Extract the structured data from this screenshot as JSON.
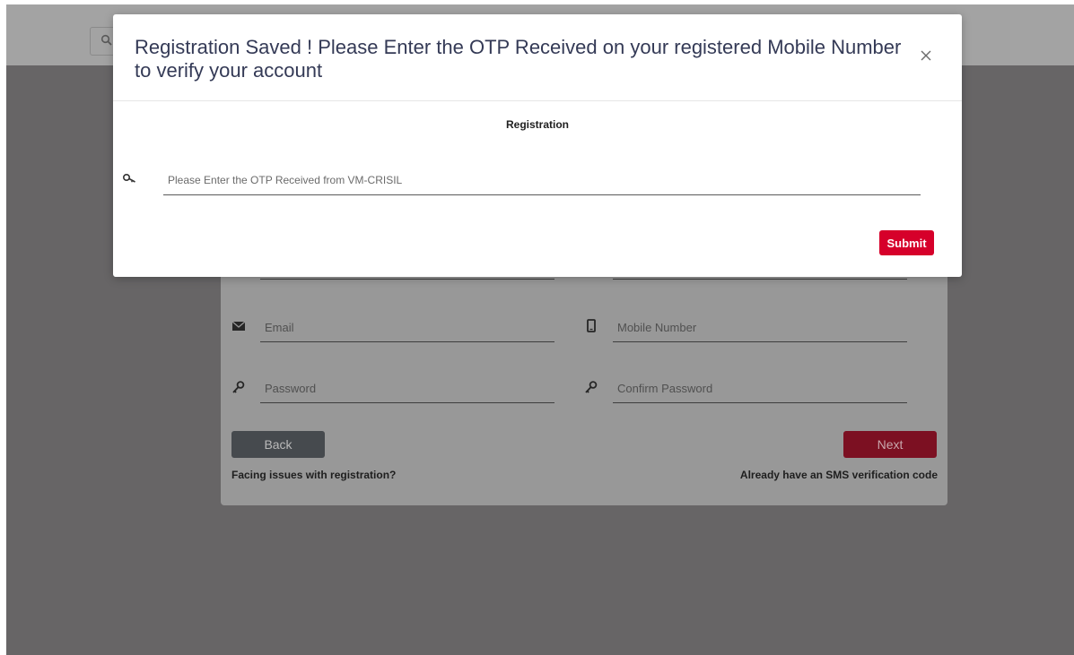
{
  "colors": {
    "backdrop": "#676566",
    "topbar": "#a3a3a3",
    "card": "#989898",
    "accent_red": "#d6002a",
    "title_text": "#343a56"
  },
  "topbar": {
    "search_icon": "search-icon"
  },
  "registration_form": {
    "fields": [
      {
        "icon": "envelope-icon",
        "placeholder": "Email"
      },
      {
        "icon": "mobile-phone-icon",
        "placeholder": "Mobile Number"
      },
      {
        "icon": "key-icon",
        "placeholder": "Password"
      },
      {
        "icon": "key-icon",
        "placeholder": "Confirm Password"
      }
    ],
    "back_label": "Back",
    "next_label": "Next",
    "issues_link": "Facing issues with registration?",
    "sms_link": "Already have an SMS verification code"
  },
  "modal": {
    "title": "Registration Saved ! Please Enter the OTP Received on your registered Mobile Number to verify your account",
    "close_icon": "close-icon",
    "subtitle": "Registration",
    "otp_icon": "key-icon",
    "otp_placeholder": "Please Enter the OTP Received from VM-CRISIL",
    "otp_value": "",
    "submit_label": "Submit"
  }
}
